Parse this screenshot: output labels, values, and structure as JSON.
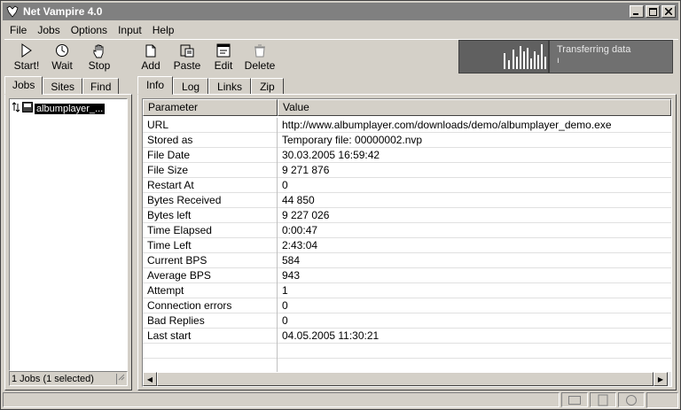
{
  "window": {
    "title": "Net Vampire 4.0"
  },
  "menu": [
    "File",
    "Jobs",
    "Options",
    "Input",
    "Help"
  ],
  "toolbar": {
    "start": "Start!",
    "wait": "Wait",
    "stop": "Stop",
    "add": "Add",
    "paste": "Paste",
    "edit": "Edit",
    "delete": "Delete"
  },
  "transfer": {
    "status": "Transferring data",
    "cursor": "ı"
  },
  "left_tabs": [
    "Jobs",
    "Sites",
    "Find"
  ],
  "jobs": {
    "selected_item": "albumplayer_...",
    "status": "1 Jobs (1 selected)"
  },
  "right_tabs": [
    "Info",
    "Log",
    "Links",
    "Zip"
  ],
  "grid": {
    "headers": [
      "Parameter",
      "Value"
    ],
    "rows": [
      [
        "URL",
        "http://www.albumplayer.com/downloads/demo/albumplayer_demo.exe"
      ],
      [
        "Stored as",
        "Temporary file: 00000002.nvp"
      ],
      [
        "File Date",
        "30.03.2005 16:59:42"
      ],
      [
        "File Size",
        "9 271 876"
      ],
      [
        "Restart At",
        "0"
      ],
      [
        "Bytes Received",
        "44 850"
      ],
      [
        "Bytes left",
        "9 227 026"
      ],
      [
        "Time Elapsed",
        "0:00:47"
      ],
      [
        "Time Left",
        "2:43:04"
      ],
      [
        "Current BPS",
        "584"
      ],
      [
        "Average BPS",
        "943"
      ],
      [
        "Attempt",
        "1"
      ],
      [
        "Connection errors",
        "0"
      ],
      [
        "Bad Replies",
        "0"
      ],
      [
        "Last start",
        "04.05.2005 11:30:21"
      ],
      [
        "",
        ""
      ],
      [
        "",
        ""
      ]
    ]
  }
}
